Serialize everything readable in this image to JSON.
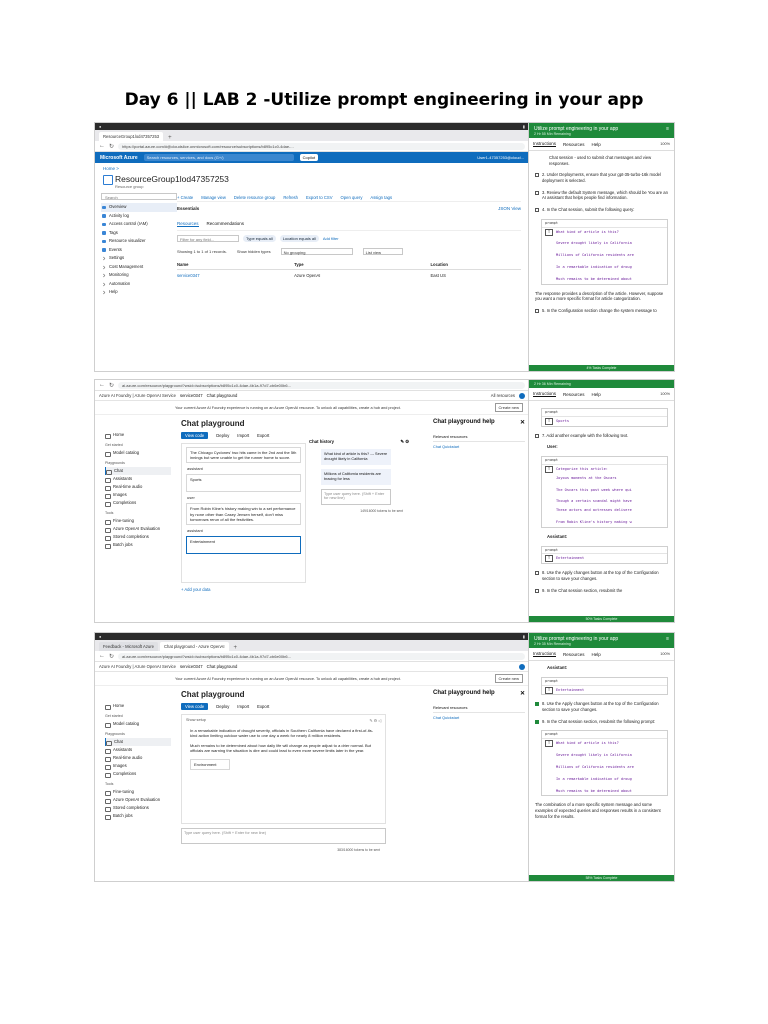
{
  "document": {
    "title": "Day 6 || LAB 2 -Utilize prompt engineering in your app"
  },
  "shot1": {
    "tabs": [
      "ResourceGroup1lod47357253",
      "+"
    ],
    "url": "https://portal.azure.com/#@cloudslice.onmicrosoft.com/resource/subscriptions/b895c1c0-4dae-...",
    "topbar": {
      "brand": "Microsoft Azure",
      "search": "Search resources, services, and docs (G+/)",
      "copilot": "Copilot",
      "user": "User1-47357253@cloud..."
    },
    "breadcrumb": "Home >",
    "title": "ResourceGroup1lod47357253",
    "subtitle": "Resource group",
    "menu": {
      "search": "Search",
      "items": [
        "Overview",
        "Activity log",
        "Access control (IAM)",
        "Tags",
        "Resource visualizer",
        "Events",
        "Settings",
        "Cost Management",
        "Monitoring",
        "Automation",
        "Help"
      ]
    },
    "commands": [
      "+ Create",
      "Manage view",
      "Delete resource group",
      "Refresh",
      "Export to CSV",
      "Open query",
      "Assign tags"
    ],
    "essentials": "Essentials",
    "json_view": "JSON View",
    "resource_tabs": [
      "Resources",
      "Recommendations"
    ],
    "filter_placeholder": "Filter for any field...",
    "chips": [
      "Type equals all",
      "Location equals all"
    ],
    "add_filter": "Add filter",
    "showing": "Showing 1 to 1 of 1 records.",
    "show_hidden": "Show hidden types",
    "grouping": "No grouping",
    "list_view": "List view",
    "columns": [
      "Name",
      "Type",
      "Location"
    ],
    "rows": [
      {
        "name": "service0347",
        "type": "Azure OpenAI",
        "location": "East US"
      }
    ]
  },
  "lab1": {
    "title": "Utilize prompt engineering in your app",
    "timer": "2 Hr 55 Min Remaining",
    "tabs": [
      "Instructions",
      "Resources",
      "Help"
    ],
    "pct": "100%",
    "bullet": "Chat session - used to submit chat messages and view responses.",
    "step2": "2. Under Deployments, ensure that your gpt-35-turbo-16k model deployment is selected.",
    "step3": "3. Review the default System message, which should be You are an AI assistant that helps people find information.",
    "step4": "4. In the Chat session, submit the following query:",
    "code_label": "prompt",
    "code_lines": [
      "What kind of article is this?",
      "Severe drought likely in California",
      "Millions of California residents are",
      "In a remarkable indication of droug",
      "Much remains to be determined about"
    ],
    "para": "The response provides a description of the article. However, suppose you want a more specific format for article categorization.",
    "step5": "5. In the Configuration section change the system message to",
    "footer": "4% Tasks Complete"
  },
  "shot2": {
    "url": "ai.azure.com/resource/playground?wsid=/subscriptions/b895c1c0-4dae-4b1a-97d7-cb6e00b6...",
    "project": "Azure AI Foundry | Azure OpenAI Service",
    "service": "service0347",
    "page": "Chat playground",
    "resources": "All resources",
    "notice": "Your current Azure AI Foundry experience is running on an Azure OpenAI resource. To unlock all capabilities, create a hub and project.",
    "create": "Create new",
    "nav": [
      "Home",
      "Get started",
      "Model catalog",
      "Playgrounds",
      "Chat",
      "Assistants",
      "Real-time audio",
      "Images",
      "Completions",
      "Tools",
      "Fine-tuning",
      "Azure OpenAI Evaluation",
      "Stored completions",
      "Batch jobs"
    ],
    "title": "Chat playground",
    "toolbar": [
      "View code",
      "Deploy",
      "Import",
      "Export"
    ],
    "msg1": "The Chicago Cyclones' two hits came in the 2nd and the 5th innings but were unable to get the runner home to score.",
    "role_assistant": "assistant",
    "answer1": "Sports",
    "role_user": "user",
    "msg2": "From Robin Kline's history making win to a set performance by none other than Casey Jensen herself, don't miss tomorrows rerun of all the festivities.",
    "answer2": "Entertainment",
    "add_data": "+ Add your data",
    "history_title": "Chat history",
    "bubble1": "What kind of article is this? --- Severe drought likely in California",
    "bubble2": "Millions of California residents are bracing for less",
    "input_placeholder": "Type user query here. (Shift + Enter for new line)",
    "tokens": "149/16000 tokens to be sent",
    "help_title": "Chat playground help",
    "relevant": "Relevant resources",
    "quickstart": "Chat Quickstart"
  },
  "lab2": {
    "timer": "2 Hr 36 Min Remaining",
    "tabs": [
      "Instructions",
      "Resources",
      "Help"
    ],
    "pct": "100%",
    "code_label": "prompt",
    "top_code": "Sports",
    "step7": "7. Add another example with the following text.",
    "user": "User:",
    "code2": [
      "Categorize this article:",
      "Joyous moments at the Oscars",
      "The Oscars this past week where qui",
      "Though a certain scandal might have",
      "These actors and actresses delivere",
      "From Robin Kline's history making w"
    ],
    "assistant": "Assistant:",
    "ans": "Entertainment",
    "step8": "8. Use the Apply changes button at the top of the Configuration section to save your changes.",
    "step9": "9. In the Chat session section, resubmit the",
    "footer": "50% Tasks Complete"
  },
  "shot3": {
    "tabs": [
      "Feedback - Microsoft Azure",
      "Chat playground - Azure OpenAI",
      "+"
    ],
    "url": "ai.azure.com/resource/playground?wsid=/subscriptions/b895c1c0-4dae-4b1a-97d7-cb6e00b6...",
    "project": "Azure AI Foundry | Azure OpenAI Service",
    "service": "service0347",
    "page": "Chat playground",
    "notice": "Your current Azure AI Foundry experience is running on an Azure OpenAI resource. To unlock all capabilities, create a hub and project.",
    "create": "Create new",
    "title": "Chat playground",
    "toolbar": [
      "View code",
      "Deploy",
      "Import",
      "Export"
    ],
    "show_setup": "Show setup",
    "para1": "In a remarkable indication of drought severity, officials in Southern California have declared a first-of-its-kind action limiting outdoor water use to one day a week for nearly 8 million residents.",
    "para2": "Much remains to be determined about how daily life will change as people adjust to a drier normal. But officials are warning the situation is dire and could lead to even more severe limits later in the year.",
    "answer": "Environment",
    "input_placeholder": "Type user query here. (Shift + Enter for new line)",
    "tokens": "383/16000 tokens to be sent",
    "help_title": "Chat playground help",
    "relevant": "Relevant resources",
    "quickstart": "Chat Quickstart"
  },
  "lab3": {
    "title": "Utilize prompt engineering in your app",
    "timer": "2 Hr 35 Min Remaining",
    "tabs": [
      "Instructions",
      "Resources",
      "Help"
    ],
    "pct": "100%",
    "assistant": "Assistant:",
    "code_label": "prompt",
    "ans": "Entertainment",
    "step8": "8. Use the Apply changes button at the top of the Configuration section to save your changes.",
    "step9": "9. In the Chat session section, resubmit the following prompt:",
    "code_lines": [
      "What kind of article is this?",
      "Severe drought likely in California",
      "Millions of California residents are",
      "In a remarkable indication of droug",
      "Much remains to be determined about"
    ],
    "para": "The combination of a more specific system message and some examples of expected queries and responses results in a consistent format for the results.",
    "footer": "58% Tasks Complete"
  }
}
